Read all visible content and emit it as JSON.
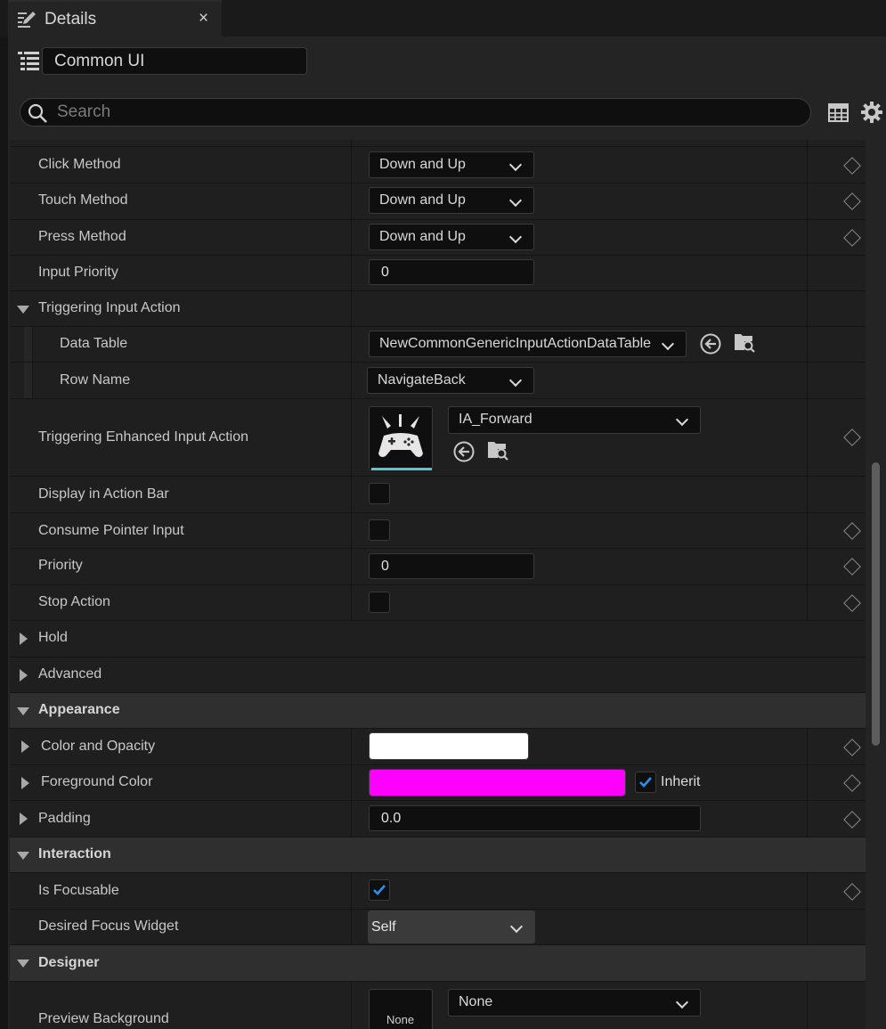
{
  "tab": {
    "title": "Details",
    "close": "×"
  },
  "header": {
    "object_name": "Common UI"
  },
  "search": {
    "placeholder": "Search"
  },
  "colors": {
    "accent_check": "#2f8ff0",
    "foreground_color": "#ff00ff",
    "color_and_opacity": "#ffffff",
    "thumb_underline": "#4fc8d8"
  },
  "props": {
    "click_method": {
      "label": "Click Method",
      "value": "Down and Up"
    },
    "touch_method": {
      "label": "Touch Method",
      "value": "Down and Up"
    },
    "press_method": {
      "label": "Press Method",
      "value": "Down and Up"
    },
    "input_priority": {
      "label": "Input Priority",
      "value": "0"
    },
    "triggering_input_action": {
      "label": "Triggering Input Action"
    },
    "data_table": {
      "label": "Data Table",
      "value": "NewCommonGenericInputActionDataTable"
    },
    "row_name": {
      "label": "Row Name",
      "value": "NavigateBack"
    },
    "enhanced_input_action": {
      "label": "Triggering Enhanced Input Action",
      "value": "IA_Forward"
    },
    "display_in_action_bar": {
      "label": "Display in Action Bar",
      "checked": false
    },
    "consume_pointer_input": {
      "label": "Consume Pointer Input",
      "checked": false
    },
    "priority": {
      "label": "Priority",
      "value": "0"
    },
    "stop_action": {
      "label": "Stop Action",
      "checked": false
    },
    "hold": {
      "label": "Hold"
    },
    "advanced": {
      "label": "Advanced"
    },
    "appearance": {
      "label": "Appearance"
    },
    "color_and_opacity": {
      "label": "Color and Opacity"
    },
    "foreground_color": {
      "label": "Foreground Color",
      "inherit_label": "Inherit",
      "inherit_checked": true
    },
    "padding": {
      "label": "Padding",
      "value": "0.0"
    },
    "interaction": {
      "label": "Interaction"
    },
    "is_focusable": {
      "label": "Is Focusable",
      "checked": true
    },
    "desired_focus_widget": {
      "label": "Desired Focus Widget",
      "value": "Self"
    },
    "designer": {
      "label": "Designer"
    },
    "preview_background": {
      "label": "Preview Background",
      "value": "None",
      "thumb_text": "None"
    }
  }
}
